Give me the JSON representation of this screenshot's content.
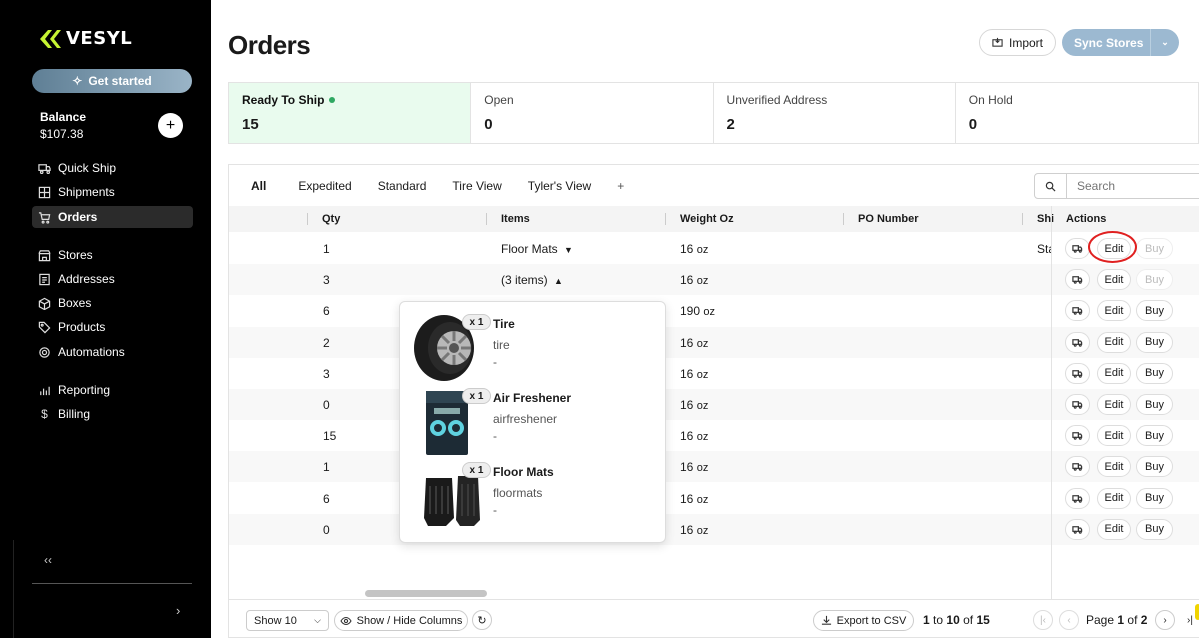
{
  "brand": {
    "name": "VESYL",
    "accent": "#c6f432"
  },
  "sidebar": {
    "get_started": "Get started",
    "balance_label": "Balance",
    "balance_value": "$107.38",
    "add_icon": "plus-icon",
    "items": [
      {
        "label": "Quick Ship",
        "icon": "truck-icon"
      },
      {
        "label": "Shipments",
        "icon": "grid-icon"
      },
      {
        "label": "Orders",
        "icon": "cart-icon",
        "active": true
      },
      {
        "label": "Stores",
        "icon": "store-icon"
      },
      {
        "label": "Addresses",
        "icon": "address-book-icon"
      },
      {
        "label": "Boxes",
        "icon": "box-icon"
      },
      {
        "label": "Products",
        "icon": "tag-icon"
      },
      {
        "label": "Automations",
        "icon": "gear-icon"
      },
      {
        "label": "Reporting",
        "icon": "bar-chart-icon"
      },
      {
        "label": "Billing",
        "icon": "dollar-icon"
      }
    ],
    "collapse_glyph": "|<",
    "expand_glyph": ">"
  },
  "header": {
    "title": "Orders",
    "import_label": "Import",
    "sync_label": "Sync Stores"
  },
  "stats": [
    {
      "name": "Ready To Ship",
      "value": "15",
      "active": true
    },
    {
      "name": "Open",
      "value": "0"
    },
    {
      "name": "Unverified Address",
      "value": "2"
    },
    {
      "name": "On Hold",
      "value": "0"
    }
  ],
  "tabs": [
    "All",
    "Expedited",
    "Standard",
    "Tire View",
    "Tyler's View",
    "+"
  ],
  "search": {
    "placeholder": "Search"
  },
  "columns": {
    "qty": "Qty",
    "items": "Items",
    "weight": "Weight Oz",
    "po": "PO Number",
    "ship": "Shi",
    "actions": "Actions"
  },
  "actions": {
    "edit": "Edit",
    "buy": "Buy"
  },
  "rows": [
    {
      "qty": "1",
      "items": "Floor Mats",
      "caret": "down",
      "weight": "16",
      "unit": "oz",
      "ship": "Sta",
      "buy_disabled": true
    },
    {
      "qty": "3",
      "items": "(3 items)",
      "caret": "up",
      "weight": "16",
      "unit": "oz",
      "ship": "",
      "buy_disabled": true
    },
    {
      "qty": "6",
      "items": "",
      "weight": "190",
      "unit": "oz",
      "ship": ""
    },
    {
      "qty": "2",
      "items": "",
      "weight": "16",
      "unit": "oz",
      "ship": ""
    },
    {
      "qty": "3",
      "items": "",
      "weight": "16",
      "unit": "oz",
      "ship": ""
    },
    {
      "qty": "0",
      "items": "",
      "weight": "16",
      "unit": "oz",
      "ship": ""
    },
    {
      "qty": "15",
      "items": "",
      "weight": "16",
      "unit": "oz",
      "ship": ""
    },
    {
      "qty": "1",
      "items": "",
      "weight": "16",
      "unit": "oz",
      "ship": ""
    },
    {
      "qty": "6",
      "items": "",
      "weight": "16",
      "unit": "oz",
      "ship": ""
    },
    {
      "qty": "0",
      "items": "",
      "weight": "16",
      "unit": "oz",
      "ship": ""
    }
  ],
  "popup": {
    "items": [
      {
        "qty": "x 1",
        "name": "Tire",
        "sku": "tire",
        "extra": "-"
      },
      {
        "qty": "x 1",
        "name": "Air Freshener",
        "sku": "airfreshener",
        "extra": "-"
      },
      {
        "qty": "x 1",
        "name": "Floor Mats",
        "sku": "floormats",
        "extra": "-"
      }
    ]
  },
  "footer": {
    "page_size": "Show 10",
    "show_hide": "Show / Hide Columns",
    "export": "Export to CSV",
    "range_start": "1",
    "range_to": "to",
    "range_end": "10",
    "range_of": "of",
    "range_total": "15",
    "page_label": "Page",
    "page_current": "1",
    "page_of": "of",
    "page_total": "2"
  }
}
